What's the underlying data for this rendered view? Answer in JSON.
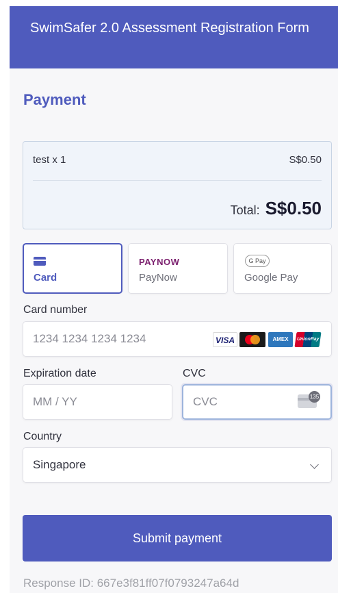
{
  "header": {
    "title": "SwimSafer 2.0 Assessment Registration Form"
  },
  "section": {
    "title": "Payment"
  },
  "summary": {
    "items": [
      {
        "name": "test x 1",
        "price": "S$0.50"
      }
    ],
    "total_label": "Total:",
    "total_value": "S$0.50"
  },
  "payment_methods": [
    {
      "label": "Card",
      "icon": "credit-card-icon",
      "selected": true
    },
    {
      "label": "PayNow",
      "logo_text": "PAYNOW",
      "icon": "paynow-logo"
    },
    {
      "label": "Google Pay",
      "logo_text": "G Pay",
      "icon": "google-pay-logo"
    }
  ],
  "card": {
    "number_label": "Card number",
    "number_placeholder": "1234 1234 1234 1234",
    "brands": [
      "VISA",
      "Mastercard",
      "AMEX",
      "UnionPay"
    ],
    "expiry_label": "Expiration date",
    "expiry_placeholder": "MM / YY",
    "cvc_label": "CVC",
    "cvc_placeholder": "CVC",
    "cvc_badge": "135",
    "country_label": "Country",
    "country_value": "Singapore"
  },
  "submit": {
    "label": "Submit payment"
  },
  "footer": {
    "response_id": "Response ID: 667e3f81ff07f0793247a64d"
  },
  "colors": {
    "primary": "#4f5bbd",
    "background": "#f7f7f9"
  }
}
